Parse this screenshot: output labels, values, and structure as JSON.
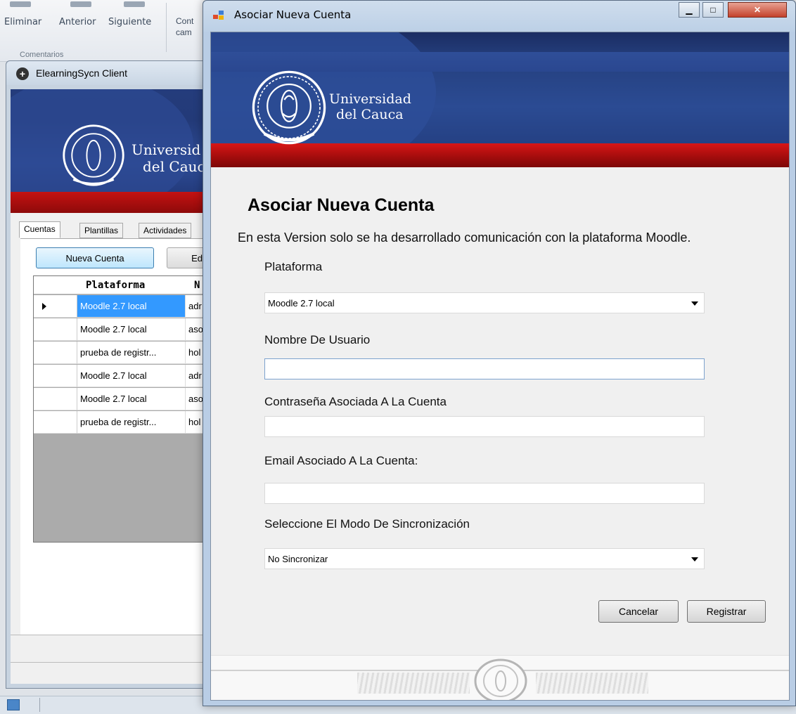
{
  "ribbon": {
    "eliminar": "Eliminar",
    "anterior": "Anterior",
    "siguiente": "Siguiente",
    "cont_line1": "Cont",
    "cont_line2": "cam",
    "group_label": "Comentarios"
  },
  "bg_window": {
    "title": "ElearningSycn Client",
    "banner_line1": "Universid",
    "banner_line2": "del Cauc",
    "tabs": [
      "Cuentas",
      "Plantillas",
      "Actividades"
    ],
    "new_account_button": "Nueva Cuenta",
    "edit_button": "Ed",
    "grid": {
      "headers": [
        "Plataforma",
        "N"
      ],
      "rows": [
        {
          "plataforma": "Moodle 2.7 local",
          "n": "adr",
          "current": true
        },
        {
          "plataforma": "Moodle 2.7 local",
          "n": "aso"
        },
        {
          "plataforma": "prueba de registr...",
          "n": "hol"
        },
        {
          "plataforma": "Moodle 2.7 local",
          "n": "adr"
        },
        {
          "plataforma": "Moodle 2.7 local",
          "n": "aso"
        },
        {
          "plataforma": "prueba de registr...",
          "n": "hol"
        }
      ]
    }
  },
  "dialog": {
    "title": "Asociar Nueva Cuenta",
    "banner_line1": "Universidad",
    "banner_line2": "del Cauca",
    "heading": "Asociar Nueva Cuenta",
    "subtitle": "En esta Version solo se ha desarrollado comunicación con la plataforma Moodle.",
    "plataforma_label": "Plataforma",
    "plataforma_value": "Moodle 2.7 local",
    "usuario_label": "Nombre De Usuario",
    "usuario_value": "",
    "password_label": "Contraseña Asociada A La Cuenta",
    "password_value": "",
    "email_label": "Email Asociado A La Cuenta:",
    "email_value": "",
    "sync_label": "Seleccione El Modo De Sincronización",
    "sync_value": "No Sincronizar",
    "cancel_button": "Cancelar",
    "register_button": "Registrar"
  },
  "colors": {
    "banner_blue": "#2b4b93",
    "banner_red": "#c51212",
    "selection": "#3399ff"
  }
}
